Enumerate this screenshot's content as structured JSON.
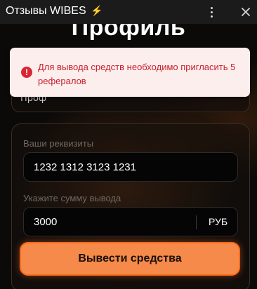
{
  "header": {
    "title": "Отзывы WIBES",
    "bolt_icon": "⚡",
    "menu_icon": "more-vertical-icon",
    "close_icon": "close-icon"
  },
  "page": {
    "title": "Профиль",
    "partial_card_text": "Проф"
  },
  "toast": {
    "type": "error",
    "icon": "error-icon",
    "message": "Для вывода средств необходимо пригласить 5 рефералов",
    "color": "#c81e2a",
    "background": "#fdeeee"
  },
  "withdraw": {
    "details_label": "Ваши реквизиты",
    "details_value": "1232 1312 3123 1231",
    "amount_label": "Укажите сумму вывода",
    "amount_value": "3000",
    "currency": "РУБ",
    "button_label": "Вывести средства",
    "accent": "#f58a4a"
  }
}
